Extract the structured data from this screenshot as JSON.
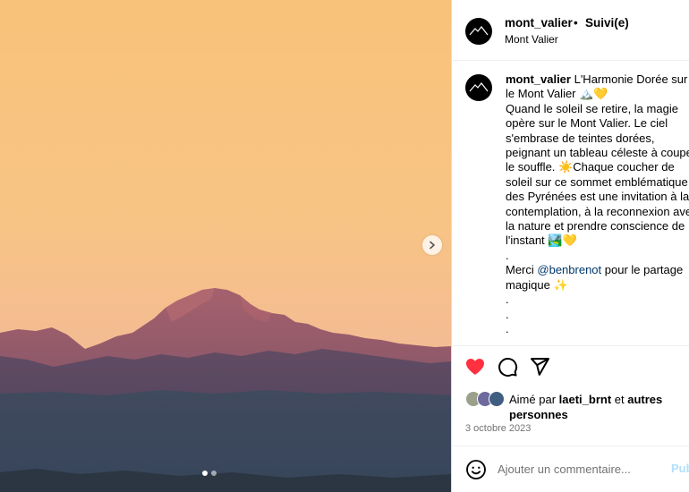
{
  "post": {
    "username": "mont_valier",
    "separator": "•",
    "follow_status": "Suivi(e)",
    "location": "Mont Valier",
    "caption_username": "mont_valier",
    "caption_part1": " L'Harmonie Dorée sur le Mont Valier 🏔️💛\nQuand le soleil se retire, la magie opère sur le Mont Valier. Le ciel s'embrase de teintes dorées, peignant un tableau céleste à couper le souffle. ☀️Chaque coucher de soleil sur ce sommet emblématique des Pyrénées est une invitation à la contemplation, à la reconnexion avec la nature et prendre conscience de l'instant 🏞️💛\n.\nMerci ",
    "mention": "@benbrenot",
    "caption_part2": " pour le partage magique ✨\n.\n.\n.",
    "likes_prefix": "Aimé par ",
    "likes_user": "laeti_brnt",
    "likes_middle": " et ",
    "likes_others": "autres personnes",
    "date": "3 octobre 2023",
    "comment_placeholder": "Ajouter un commentaire...",
    "post_button": "Publier"
  },
  "carousel": {
    "total": 2,
    "current": 1
  },
  "icons": {
    "heart": "heart-icon",
    "comment": "comment-icon",
    "share": "share-icon",
    "emoji": "emoji-icon",
    "next": "chevron-right-icon"
  },
  "colors": {
    "like_red": "#ff3040",
    "mention_blue": "#00376b",
    "post_disabled": "#b2dffc",
    "sky_top": "#f9c47a",
    "sky_bottom": "#f2b996"
  }
}
